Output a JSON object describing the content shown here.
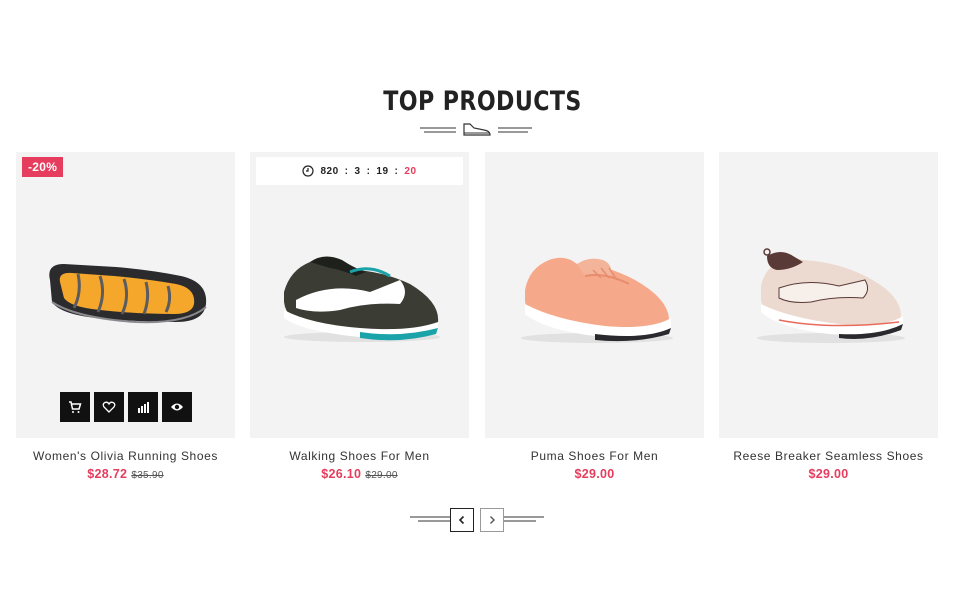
{
  "section": {
    "title": "TOP PRODUCTS"
  },
  "products": [
    {
      "name": "Women's Olivia Running Shoes",
      "price": "$28.72",
      "old_price": "$35.90",
      "badge": "-20%"
    },
    {
      "name": "Walking Shoes For Men",
      "price": "$26.10",
      "old_price": "$29.00",
      "countdown": {
        "days": "820",
        "hours": "3",
        "minutes": "19",
        "seconds": "20",
        "sep": ":"
      }
    },
    {
      "name": "Puma Shoes For Men",
      "price": "$29.00"
    },
    {
      "name": "Reese Breaker Seamless Shoes",
      "price": "$29.00"
    }
  ],
  "actions": [
    "cart-icon",
    "heart-icon",
    "compare-icon",
    "eye-icon"
  ],
  "colors": {
    "accent": "#e63c5d",
    "card_bg": "#f4f3f4",
    "dark": "#111111"
  }
}
